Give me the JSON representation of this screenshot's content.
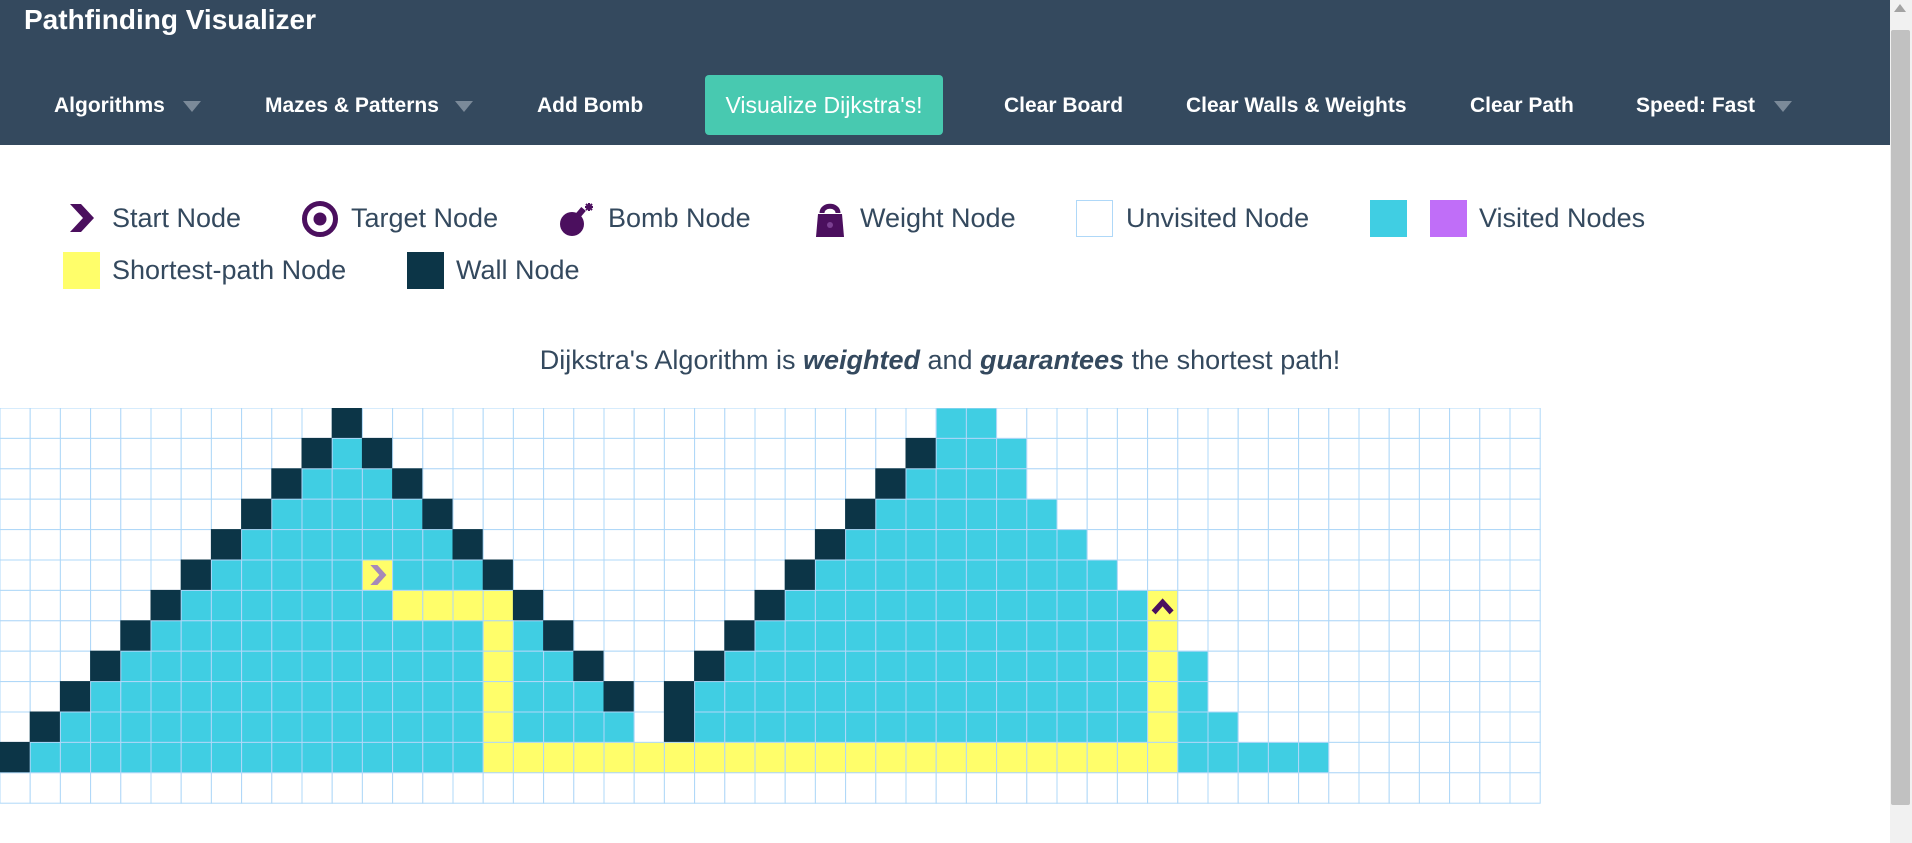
{
  "navbar": {
    "brand": "Pathfinding Visualizer",
    "algorithms": "Algorithms",
    "mazes": "Mazes & Patterns",
    "add_bomb": "Add Bomb",
    "visualize": "Visualize Dijkstra's!",
    "clear_board": "Clear Board",
    "clear_walls": "Clear Walls & Weights",
    "clear_path": "Clear Path",
    "speed": "Speed: Fast"
  },
  "legend": {
    "start": "Start Node",
    "target": "Target Node",
    "bomb": "Bomb Node",
    "weight": "Weight Node",
    "unvisited": "Unvisited Node",
    "visited": "Visited Nodes",
    "shortest": "Shortest-path Node",
    "wall": "Wall Node"
  },
  "description": {
    "pre": "Dijkstra's Algorithm is ",
    "weighted": "weighted",
    "mid": " and ",
    "guarantees": "guarantees",
    "post": " the shortest path!"
  },
  "colors": {
    "navbar": "#34495e",
    "visualize_button": "#48c9b0",
    "visited": "#40cee3",
    "visited_alt": "#c06ef8",
    "shortest_path": "#fffe6a",
    "wall": "#0c3547",
    "grid_line": "#afd8f8",
    "icon_purple": "#4b0f5e",
    "text": "#34495e"
  },
  "grid": {
    "cols": 51,
    "rows_visible": 12,
    "start": [
      5,
      12
    ],
    "target": [
      6,
      38
    ],
    "walls": [
      [
        0,
        11
      ],
      [
        1,
        10
      ],
      [
        1,
        12
      ],
      [
        2,
        9
      ],
      [
        2,
        13
      ],
      [
        3,
        8
      ],
      [
        3,
        14
      ],
      [
        4,
        7
      ],
      [
        4,
        15
      ],
      [
        5,
        6
      ],
      [
        5,
        16
      ],
      [
        6,
        5
      ],
      [
        6,
        17
      ],
      [
        7,
        4
      ],
      [
        7,
        18
      ],
      [
        8,
        3
      ],
      [
        8,
        19
      ],
      [
        9,
        2
      ],
      [
        9,
        20
      ],
      [
        10,
        1
      ],
      [
        10,
        22
      ],
      [
        11,
        0
      ],
      [
        11,
        21
      ],
      [
        1,
        30
      ],
      [
        2,
        29
      ],
      [
        3,
        28
      ],
      [
        4,
        27
      ],
      [
        5,
        26
      ],
      [
        6,
        25
      ],
      [
        7,
        24
      ],
      [
        8,
        23
      ],
      [
        9,
        22
      ]
    ],
    "visited_ranges": [
      [
        0,
        31,
        32
      ],
      [
        1,
        11,
        11
      ],
      [
        1,
        31,
        33
      ],
      [
        2,
        10,
        12
      ],
      [
        2,
        30,
        33
      ],
      [
        3,
        9,
        13
      ],
      [
        3,
        29,
        34
      ],
      [
        4,
        8,
        14
      ],
      [
        4,
        28,
        35
      ],
      [
        5,
        7,
        15
      ],
      [
        5,
        27,
        36
      ],
      [
        6,
        6,
        16
      ],
      [
        6,
        26,
        37
      ],
      [
        7,
        5,
        17
      ],
      [
        7,
        25,
        37
      ],
      [
        8,
        4,
        18
      ],
      [
        8,
        24,
        39
      ],
      [
        9,
        3,
        19
      ],
      [
        9,
        23,
        39
      ],
      [
        10,
        2,
        20
      ],
      [
        10,
        23,
        40
      ],
      [
        11,
        1,
        20
      ],
      [
        11,
        22,
        43
      ]
    ],
    "path_cells": [
      [
        6,
        13
      ],
      [
        6,
        14
      ],
      [
        6,
        15
      ],
      [
        6,
        16
      ],
      [
        7,
        16
      ],
      [
        8,
        16
      ],
      [
        9,
        16
      ],
      [
        10,
        16
      ],
      [
        11,
        16
      ],
      [
        11,
        17
      ],
      [
        11,
        18
      ],
      [
        11,
        19
      ],
      [
        11,
        20
      ],
      [
        11,
        21
      ],
      [
        11,
        22
      ],
      [
        11,
        23
      ],
      [
        11,
        24
      ],
      [
        11,
        25
      ],
      [
        11,
        26
      ],
      [
        11,
        27
      ],
      [
        11,
        28
      ],
      [
        11,
        29
      ],
      [
        11,
        30
      ],
      [
        11,
        31
      ],
      [
        11,
        32
      ],
      [
        11,
        33
      ],
      [
        11,
        34
      ],
      [
        11,
        35
      ],
      [
        11,
        36
      ],
      [
        11,
        37
      ],
      [
        11,
        38
      ],
      [
        10,
        38
      ],
      [
        9,
        38
      ],
      [
        8,
        38
      ],
      [
        7,
        38
      ]
    ]
  }
}
